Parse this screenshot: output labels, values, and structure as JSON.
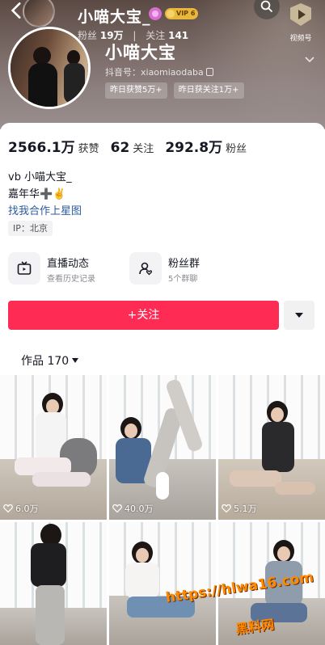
{
  "header": {
    "name": "小喵大宝_",
    "vip_label": "VIP 6",
    "stats": {
      "fans_label": "粉丝",
      "fans_value": "19万",
      "follow_label": "关注",
      "follow_value": "141"
    },
    "video_button_label": "视频号",
    "big_name": "小喵大宝",
    "douyin_id": "抖音号：xiaomiaodaba",
    "badges": [
      "昨日获赞5万+",
      "昨日获关注1万+"
    ]
  },
  "profile": {
    "stats": [
      {
        "value": "2566.1万",
        "label": "获赞"
      },
      {
        "value": "62",
        "label": "关注"
      },
      {
        "value": "292.8万",
        "label": "粉丝"
      }
    ],
    "bio": [
      "vb 小喵大宝_",
      "嘉年华➕✌️"
    ],
    "link": "找我合作上星图",
    "ip": "IP：北京"
  },
  "features": {
    "live": {
      "title": "直播动态",
      "subtitle": "查看历史记录"
    },
    "fans_group": {
      "title": "粉丝群",
      "subtitle": "5个群聊"
    }
  },
  "actions": {
    "follow_label": "+关注"
  },
  "works": {
    "tab_label": "作品 170",
    "items": [
      {
        "likes": "6.0万"
      },
      {
        "likes": "40.0万"
      },
      {
        "likes": "5.1万"
      },
      {
        "likes": ""
      },
      {
        "likes": ""
      },
      {
        "likes": ""
      }
    ]
  },
  "watermark": {
    "url": "https://hlwa16.com",
    "name": "黑料网"
  },
  "colors": {
    "accent": "#fe2c55",
    "link": "#2b5aa0",
    "watermark": "#ff8a00"
  }
}
